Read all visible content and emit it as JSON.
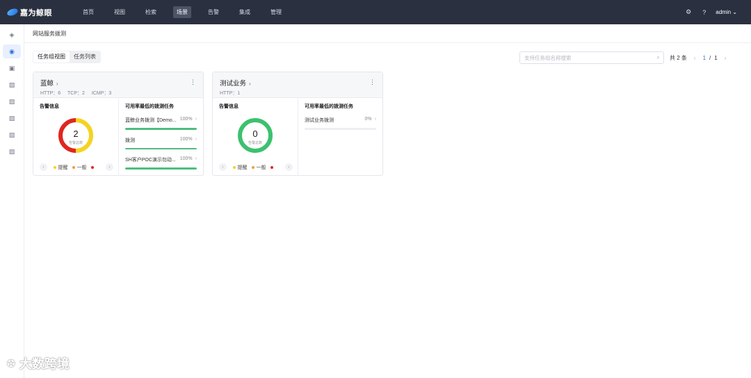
{
  "app": {
    "logo_text": "嘉为鲸眼"
  },
  "nav": [
    {
      "label": "首页"
    },
    {
      "label": "视图"
    },
    {
      "label": "检索"
    },
    {
      "label": "场景"
    },
    {
      "label": "告警"
    },
    {
      "label": "集成"
    },
    {
      "label": "管理"
    }
  ],
  "nav_active": "场景",
  "user": {
    "name": "admin"
  },
  "icons": {
    "settings": "gear-icon",
    "help": "question-circle-icon",
    "dropdown": "chevron-down-icon"
  },
  "page": {
    "breadcrumb": "网站服务拨测"
  },
  "tabs": [
    {
      "label": "任务组视图"
    },
    {
      "label": "任务列表"
    }
  ],
  "search": {
    "placeholder": "支持任务组名称搜索"
  },
  "pager": {
    "total": "共 2 条",
    "current": "1",
    "sep": "/",
    "pages": "1"
  },
  "cards": [
    {
      "title": "蓝鲸",
      "protocols": [
        "HTTP：6",
        "TCP：2",
        "ICMP：3"
      ],
      "alarm_title": "告警信息",
      "alarm_total": "2",
      "alarm_total_label": "告警总数",
      "alarm_split": {
        "reminder": 1,
        "serious": 1
      },
      "legend": [
        {
          "label": "提醒",
          "color": "#f5d321"
        },
        {
          "label": "一般",
          "color": "#f29c38"
        },
        {
          "label": "",
          "color": "#e0261f"
        }
      ],
      "task_title": "可用率最低的拨测任务",
      "tasks": [
        {
          "name": "蓝鲸业务拨测【Demo...",
          "percent": "100%",
          "fill": 1.0
        },
        {
          "name": "拨测",
          "percent": "100%",
          "fill": 1.0
        },
        {
          "name": "SH客户POC演示勿动...",
          "percent": "100%",
          "fill": 1.0
        }
      ]
    },
    {
      "title": "测试业务",
      "protocols": [
        "HTTP：1"
      ],
      "alarm_title": "告警信息",
      "alarm_total": "0",
      "alarm_total_label": "告警总数",
      "ring_color": "#3cc16e",
      "legend": [
        {
          "label": "提醒",
          "color": "#f5d321"
        },
        {
          "label": "一般",
          "color": "#f29c38"
        },
        {
          "label": "",
          "color": "#e0261f"
        }
      ],
      "task_title": "可用率最低的拨测任务",
      "tasks": [
        {
          "name": "测试业务拨测",
          "percent": "0%",
          "fill": 0.0
        }
      ]
    }
  ],
  "colors": {
    "accent": "#2f6fd9",
    "success": "#4cbe7e",
    "topbar": "#2a3040"
  },
  "watermark": {
    "text": "大数跨境"
  }
}
